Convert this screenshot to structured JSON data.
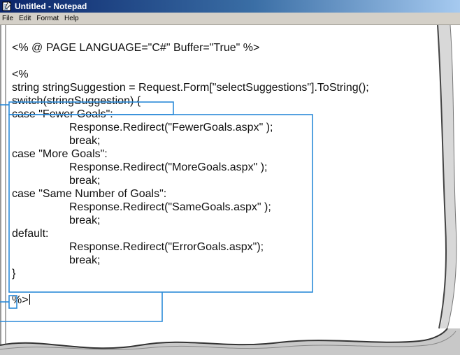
{
  "window": {
    "title": "Untitled - Notepad"
  },
  "menu": {
    "file": "File",
    "edit": "Edit",
    "format": "Format",
    "help": "Help"
  },
  "code_lines": [
    "<% @ PAGE LANGUAGE=\"C#\" Buffer=\"True\" %>",
    "",
    "<%",
    "string stringSuggestion = Request.Form[\"selectSuggestions\"].ToString();",
    "switch(stringSuggestion) {",
    "case \"Fewer Goals\":",
    "Response.Redirect(\"FewerGoals.aspx\" );",
    "break;",
    "case \"More Goals\":",
    "Response.Redirect(\"MoreGoals.aspx\" );",
    "break;",
    "case \"Same Number of Goals\":",
    "Response.Redirect(\"SameGoals.aspx\" );",
    "break;",
    "default:",
    "Response.Redirect(\"ErrorGoals.aspx\");",
    "break;",
    "}",
    "",
    "%>"
  ],
  "colors": {
    "highlight_box": "#2b8ad8",
    "titlebar_start": "#0a246a",
    "menubar": "#d4d0c8"
  }
}
